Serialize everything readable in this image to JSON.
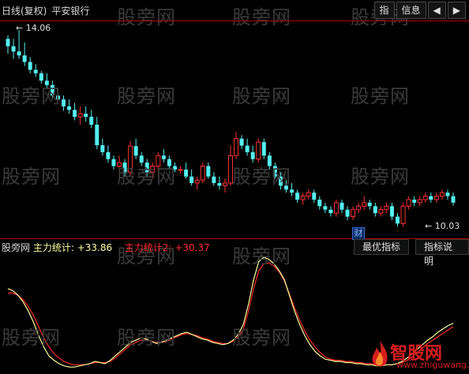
{
  "header": {
    "title": "日线(复权)",
    "stock": "平安银行",
    "buttons": [
      "指",
      "信息",
      "◀",
      "▶"
    ]
  },
  "price_labels": {
    "high": "14.06",
    "low": "10.03",
    "cai": "财"
  },
  "indicator": {
    "name": "股旁网",
    "s1_label": "主力统计:",
    "s1_value": "+33.86",
    "s2_label": "主力统计2:",
    "s2_value": "+30.37",
    "btn_best": "最优指标",
    "btn_desc": "指标说明"
  },
  "watermark": "股旁网",
  "logo": {
    "main": "智股网",
    "sub": "www.zhiguwang.com"
  },
  "colors": {
    "up": "#ff3030",
    "down": "#54f0f0",
    "s1": "#ffff9a",
    "s2": "#ff2a2a"
  },
  "chart_data": {
    "type": "candlestick",
    "candles": [
      [
        13.86,
        13.94,
        13.52,
        13.69
      ],
      [
        13.69,
        13.86,
        13.4,
        13.57
      ],
      [
        13.57,
        14.06,
        13.4,
        13.48
      ],
      [
        13.48,
        13.78,
        13.24,
        13.33
      ],
      [
        13.33,
        13.44,
        13.07,
        13.15
      ],
      [
        13.15,
        13.28,
        12.99,
        13.07
      ],
      [
        13.07,
        13.12,
        12.83,
        12.9
      ],
      [
        12.9,
        13.07,
        12.73,
        12.8
      ],
      [
        12.8,
        12.9,
        12.47,
        12.56
      ],
      [
        12.56,
        12.73,
        12.39,
        12.47
      ],
      [
        12.47,
        12.56,
        12.21,
        12.31
      ],
      [
        12.31,
        12.47,
        12.14,
        12.23
      ],
      [
        12.23,
        12.39,
        11.99,
        12.07
      ],
      [
        12.07,
        12.31,
        11.89,
        12.14
      ],
      [
        12.14,
        12.31,
        11.96,
        12.07
      ],
      [
        12.07,
        12.23,
        11.81,
        11.89
      ],
      [
        11.89,
        12.07,
        11.33,
        11.42
      ],
      [
        11.42,
        11.57,
        11.18,
        11.26
      ],
      [
        11.26,
        11.41,
        11.02,
        11.1
      ],
      [
        11.1,
        11.18,
        10.86,
        10.94
      ],
      [
        10.94,
        11.18,
        10.8,
        11.02
      ],
      [
        11.02,
        11.1,
        10.7,
        10.8
      ],
      [
        10.8,
        11.52,
        10.7,
        11.4
      ],
      [
        11.4,
        11.57,
        11.1,
        11.18
      ],
      [
        11.18,
        11.26,
        10.94,
        11.02
      ],
      [
        11.02,
        11.1,
        10.7,
        10.8
      ],
      [
        10.8,
        11.02,
        10.65,
        10.94
      ],
      [
        10.94,
        11.26,
        10.86,
        11.18
      ],
      [
        11.18,
        11.33,
        11.02,
        11.1
      ],
      [
        11.1,
        11.18,
        10.86,
        10.94
      ],
      [
        10.94,
        11.02,
        10.8,
        10.86
      ],
      [
        10.86,
        10.94,
        10.76,
        10.86
      ],
      [
        10.86,
        11.02,
        10.65,
        10.7
      ],
      [
        10.7,
        10.86,
        10.49,
        10.55
      ],
      [
        10.55,
        10.7,
        10.4,
        10.62
      ],
      [
        10.62,
        11.02,
        10.55,
        10.94
      ],
      [
        10.94,
        11.02,
        10.65,
        10.7
      ],
      [
        10.7,
        10.8,
        10.49,
        10.55
      ],
      [
        10.55,
        10.7,
        10.4,
        10.49
      ],
      [
        10.49,
        10.65,
        10.33,
        10.55
      ],
      [
        10.55,
        11.41,
        10.49,
        11.18
      ],
      [
        11.18,
        11.73,
        11.1,
        11.57
      ],
      [
        11.57,
        11.65,
        11.33,
        11.41
      ],
      [
        11.41,
        11.57,
        11.18,
        11.26
      ],
      [
        11.26,
        11.41,
        11.02,
        11.1
      ],
      [
        11.1,
        11.57,
        11.02,
        11.49
      ],
      [
        11.49,
        11.57,
        11.1,
        11.18
      ],
      [
        11.18,
        11.26,
        10.86,
        10.94
      ],
      [
        10.94,
        11.02,
        10.65,
        10.7
      ],
      [
        10.7,
        10.8,
        10.4,
        10.49
      ],
      [
        10.49,
        10.62,
        10.33,
        10.4
      ],
      [
        10.4,
        10.55,
        10.25,
        10.33
      ],
      [
        10.33,
        10.4,
        10.1,
        10.17
      ],
      [
        10.17,
        10.33,
        10.05,
        10.25
      ],
      [
        10.25,
        10.4,
        10.17,
        10.33
      ],
      [
        10.33,
        10.4,
        10.1,
        10.17
      ],
      [
        10.17,
        10.25,
        9.94,
        10.02
      ],
      [
        10.02,
        10.1,
        9.86,
        9.94
      ],
      [
        9.94,
        10.02,
        9.78,
        9.86
      ],
      [
        9.86,
        10.17,
        9.78,
        10.1
      ],
      [
        10.1,
        10.17,
        9.86,
        9.94
      ],
      [
        9.94,
        10.02,
        9.7,
        9.78
      ],
      [
        9.78,
        10.02,
        9.7,
        9.94
      ],
      [
        9.94,
        10.1,
        9.86,
        10.02
      ],
      [
        10.02,
        10.25,
        9.94,
        10.1
      ],
      [
        10.1,
        10.17,
        9.94,
        10.02
      ],
      [
        10.02,
        10.1,
        9.78,
        9.86
      ],
      [
        9.86,
        10.02,
        9.78,
        9.94
      ],
      [
        9.94,
        10.1,
        9.86,
        10.02
      ],
      [
        10.02,
        10.1,
        9.7,
        9.78
      ],
      [
        9.78,
        9.86,
        9.55,
        9.62
      ],
      [
        9.62,
        10.1,
        9.55,
        10.02
      ],
      [
        10.02,
        10.25,
        9.94,
        10.17
      ],
      [
        10.17,
        10.25,
        10.02,
        10.1
      ],
      [
        10.1,
        10.25,
        10.02,
        10.17
      ],
      [
        10.17,
        10.33,
        10.1,
        10.25
      ],
      [
        10.25,
        10.33,
        10.1,
        10.17
      ],
      [
        10.17,
        10.33,
        10.1,
        10.25
      ],
      [
        10.25,
        10.4,
        10.17,
        10.33
      ],
      [
        10.33,
        10.4,
        10.17,
        10.25
      ],
      [
        10.25,
        10.33,
        10.03,
        10.1
      ]
    ],
    "line1": [
      72,
      70,
      66,
      60,
      52,
      42,
      30,
      20,
      12,
      8,
      5,
      3,
      2,
      2,
      3,
      4,
      5,
      7,
      6,
      5,
      8,
      12,
      16,
      20,
      24,
      26,
      28,
      27,
      25,
      23,
      24,
      26,
      28,
      30,
      32,
      33,
      31,
      29,
      27,
      26,
      24,
      23,
      22,
      23,
      26,
      31,
      40,
      58,
      80,
      96,
      100,
      98,
      94,
      88,
      80,
      66,
      52,
      40,
      30,
      22,
      16,
      12,
      9,
      8,
      7,
      7,
      6,
      6,
      5,
      5,
      4,
      4,
      3,
      3,
      4,
      4,
      5,
      7,
      10,
      14,
      18,
      22,
      26,
      29,
      33,
      36,
      39,
      41
    ],
    "line2": [
      68,
      68,
      66,
      62,
      56,
      48,
      38,
      28,
      20,
      14,
      10,
      7,
      5,
      4,
      4,
      4,
      5,
      6,
      6,
      6,
      7,
      10,
      14,
      18,
      22,
      24,
      26,
      26,
      25,
      24,
      24,
      25,
      27,
      29,
      31,
      32,
      31,
      30,
      28,
      27,
      25,
      24,
      23,
      23,
      25,
      29,
      36,
      52,
      72,
      88,
      94,
      95,
      92,
      87,
      79,
      67,
      55,
      44,
      34,
      26,
      20,
      15,
      11,
      9,
      8,
      8,
      7,
      7,
      6,
      6,
      5,
      5,
      4,
      4,
      4,
      4,
      5,
      6,
      8,
      11,
      15,
      19,
      23,
      26,
      29,
      32,
      35,
      38
    ]
  }
}
